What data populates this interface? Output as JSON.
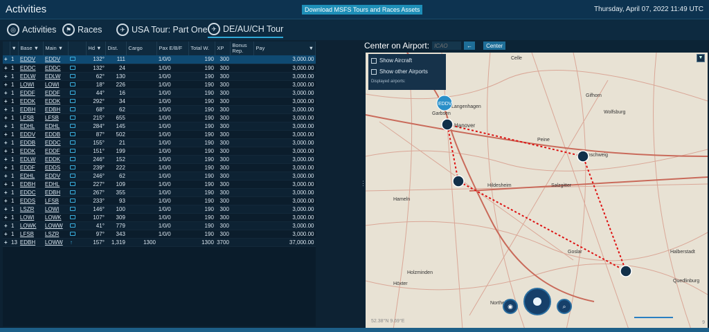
{
  "header": {
    "title": "Activities",
    "download_label": "Download MSFS Tours and Races Assets",
    "datetime": "Thursday, April 07, 2022 11:49 UTC"
  },
  "tabs": [
    {
      "label": "Activities",
      "icon": "target-icon"
    },
    {
      "label": "Races",
      "icon": "flag-icon"
    },
    {
      "label": "USA Tour: Part One",
      "icon": "plane-icon"
    },
    {
      "label": "DE/AU/CH Tour",
      "icon": "plane-icon"
    }
  ],
  "columns": [
    "Base",
    "Main",
    "Hd",
    "Dist.",
    "Cargo",
    "Pax E/B/F",
    "Total W.",
    "XP",
    "Bonus Rep.",
    "Pay"
  ],
  "rows": [
    {
      "n": "1",
      "base": "EDDV",
      "main": "EDDV",
      "hd": "132°",
      "dist": "111",
      "cargo": "",
      "pax": "1/0/0",
      "tw": "190",
      "xp": "300",
      "pay": "3,000.00",
      "sel": true
    },
    {
      "n": "1",
      "base": "EDDC",
      "main": "EDDC",
      "hd": "132°",
      "dist": "24",
      "cargo": "",
      "pax": "1/0/0",
      "tw": "190",
      "xp": "300",
      "pay": "3,000.00"
    },
    {
      "n": "1",
      "base": "EDLW",
      "main": "EDLW",
      "hd": "62°",
      "dist": "130",
      "cargo": "",
      "pax": "1/0/0",
      "tw": "190",
      "xp": "300",
      "pay": "3,000.00"
    },
    {
      "n": "1",
      "base": "LOWI",
      "main": "LOWI",
      "hd": "18°",
      "dist": "226",
      "cargo": "",
      "pax": "1/0/0",
      "tw": "190",
      "xp": "300",
      "pay": "3,000.00"
    },
    {
      "n": "1",
      "base": "EDDF",
      "main": "EDDF",
      "hd": "44°",
      "dist": "16",
      "cargo": "",
      "pax": "1/0/0",
      "tw": "190",
      "xp": "300",
      "pay": "3,000.00"
    },
    {
      "n": "1",
      "base": "EDDK",
      "main": "EDDK",
      "hd": "292°",
      "dist": "34",
      "cargo": "",
      "pax": "1/0/0",
      "tw": "190",
      "xp": "300",
      "pay": "3,000.00"
    },
    {
      "n": "1",
      "base": "EDBH",
      "main": "EDBH",
      "hd": "68°",
      "dist": "62",
      "cargo": "",
      "pax": "1/0/0",
      "tw": "190",
      "xp": "300",
      "pay": "3,000.00"
    },
    {
      "n": "1",
      "base": "LFSB",
      "main": "LFSB",
      "hd": "215°",
      "dist": "655",
      "cargo": "",
      "pax": "1/0/0",
      "tw": "190",
      "xp": "300",
      "pay": "3,000.00"
    },
    {
      "n": "1",
      "base": "EDHL",
      "main": "EDHL",
      "hd": "284°",
      "dist": "145",
      "cargo": "",
      "pax": "1/0/0",
      "tw": "190",
      "xp": "300",
      "pay": "3,000.00"
    },
    {
      "n": "1",
      "base": "EDDV",
      "main": "EDDB",
      "hd": "87°",
      "dist": "502",
      "cargo": "",
      "pax": "1/0/0",
      "tw": "190",
      "xp": "300",
      "pay": "3,000.00"
    },
    {
      "n": "1",
      "base": "EDDB",
      "main": "EDDC",
      "hd": "155°",
      "dist": "21",
      "cargo": "",
      "pax": "1/0/0",
      "tw": "190",
      "xp": "300",
      "pay": "3,000.00"
    },
    {
      "n": "1",
      "base": "EDDK",
      "main": "EDDF",
      "hd": "151°",
      "dist": "199",
      "cargo": "",
      "pax": "1/0/0",
      "tw": "190",
      "xp": "300",
      "pay": "3,000.00"
    },
    {
      "n": "1",
      "base": "EDLW",
      "main": "EDDK",
      "hd": "246°",
      "dist": "152",
      "cargo": "",
      "pax": "1/0/0",
      "tw": "190",
      "xp": "300",
      "pay": "3,000.00"
    },
    {
      "n": "1",
      "base": "EDDF",
      "main": "EDDS",
      "hd": "239°",
      "dist": "222",
      "cargo": "",
      "pax": "1/0/0",
      "tw": "190",
      "xp": "300",
      "pay": "3,000.00"
    },
    {
      "n": "1",
      "base": "EDHL",
      "main": "EDDV",
      "hd": "246°",
      "dist": "62",
      "cargo": "",
      "pax": "1/0/0",
      "tw": "190",
      "xp": "300",
      "pay": "3,000.00"
    },
    {
      "n": "1",
      "base": "EDBH",
      "main": "EDHL",
      "hd": "227°",
      "dist": "109",
      "cargo": "",
      "pax": "1/0/0",
      "tw": "190",
      "xp": "300",
      "pay": "3,000.00"
    },
    {
      "n": "1",
      "base": "EDDC",
      "main": "EDBH",
      "hd": "267°",
      "dist": "355",
      "cargo": "",
      "pax": "1/0/0",
      "tw": "190",
      "xp": "300",
      "pay": "3,000.00"
    },
    {
      "n": "1",
      "base": "EDDS",
      "main": "LFSB",
      "hd": "233°",
      "dist": "93",
      "cargo": "",
      "pax": "1/0/0",
      "tw": "190",
      "xp": "300",
      "pay": "3,000.00"
    },
    {
      "n": "1",
      "base": "LSZR",
      "main": "LOWI",
      "hd": "146°",
      "dist": "100",
      "cargo": "",
      "pax": "1/0/0",
      "tw": "190",
      "xp": "300",
      "pay": "3,000.00"
    },
    {
      "n": "1",
      "base": "LOWI",
      "main": "LOWK",
      "hd": "107°",
      "dist": "309",
      "cargo": "",
      "pax": "1/0/0",
      "tw": "190",
      "xp": "300",
      "pay": "3,000.00"
    },
    {
      "n": "1",
      "base": "LOWK",
      "main": "LOWW",
      "hd": "41°",
      "dist": "779",
      "cargo": "",
      "pax": "1/0/0",
      "tw": "190",
      "xp": "300",
      "pay": "3,000.00"
    },
    {
      "n": "1",
      "base": "LFSB",
      "main": "LSZR",
      "hd": "97°",
      "dist": "343",
      "cargo": "",
      "pax": "1/0/0",
      "tw": "190",
      "xp": "300",
      "pay": "3,000.00"
    },
    {
      "n": "13",
      "base": "EDBH",
      "main": "LOWW",
      "hd": "157°",
      "dist": "1,319",
      "cargo": "1300",
      "pax": "",
      "tw": "1300",
      "xp": "3700",
      "pay": "37,000.00",
      "total": true
    }
  ],
  "map": {
    "center_label": "Center on Airport:",
    "icao_placeholder": "ICAO",
    "center_button": "Center",
    "arrow_button": "←",
    "show_aircraft": "Show Aircraft",
    "show_other_airports": "Show other Airports",
    "displayed_airports": "Displayed airports:",
    "airport_badge": "EDDV",
    "coord_text": "52.38°N 9.69°E",
    "zoom_text": "9",
    "places": [
      "Celle",
      "Gifhorn",
      "Wolfsburg",
      "Garbsen",
      "Langenhagen",
      "Hanover",
      "Peine",
      "Braunschweig",
      "Hildesheim",
      "Salzgitter",
      "Hameln",
      "Goslar",
      "Holzminden",
      "Höxter",
      "Halberstadt",
      "Quedlinburg",
      "Northeim"
    ]
  }
}
